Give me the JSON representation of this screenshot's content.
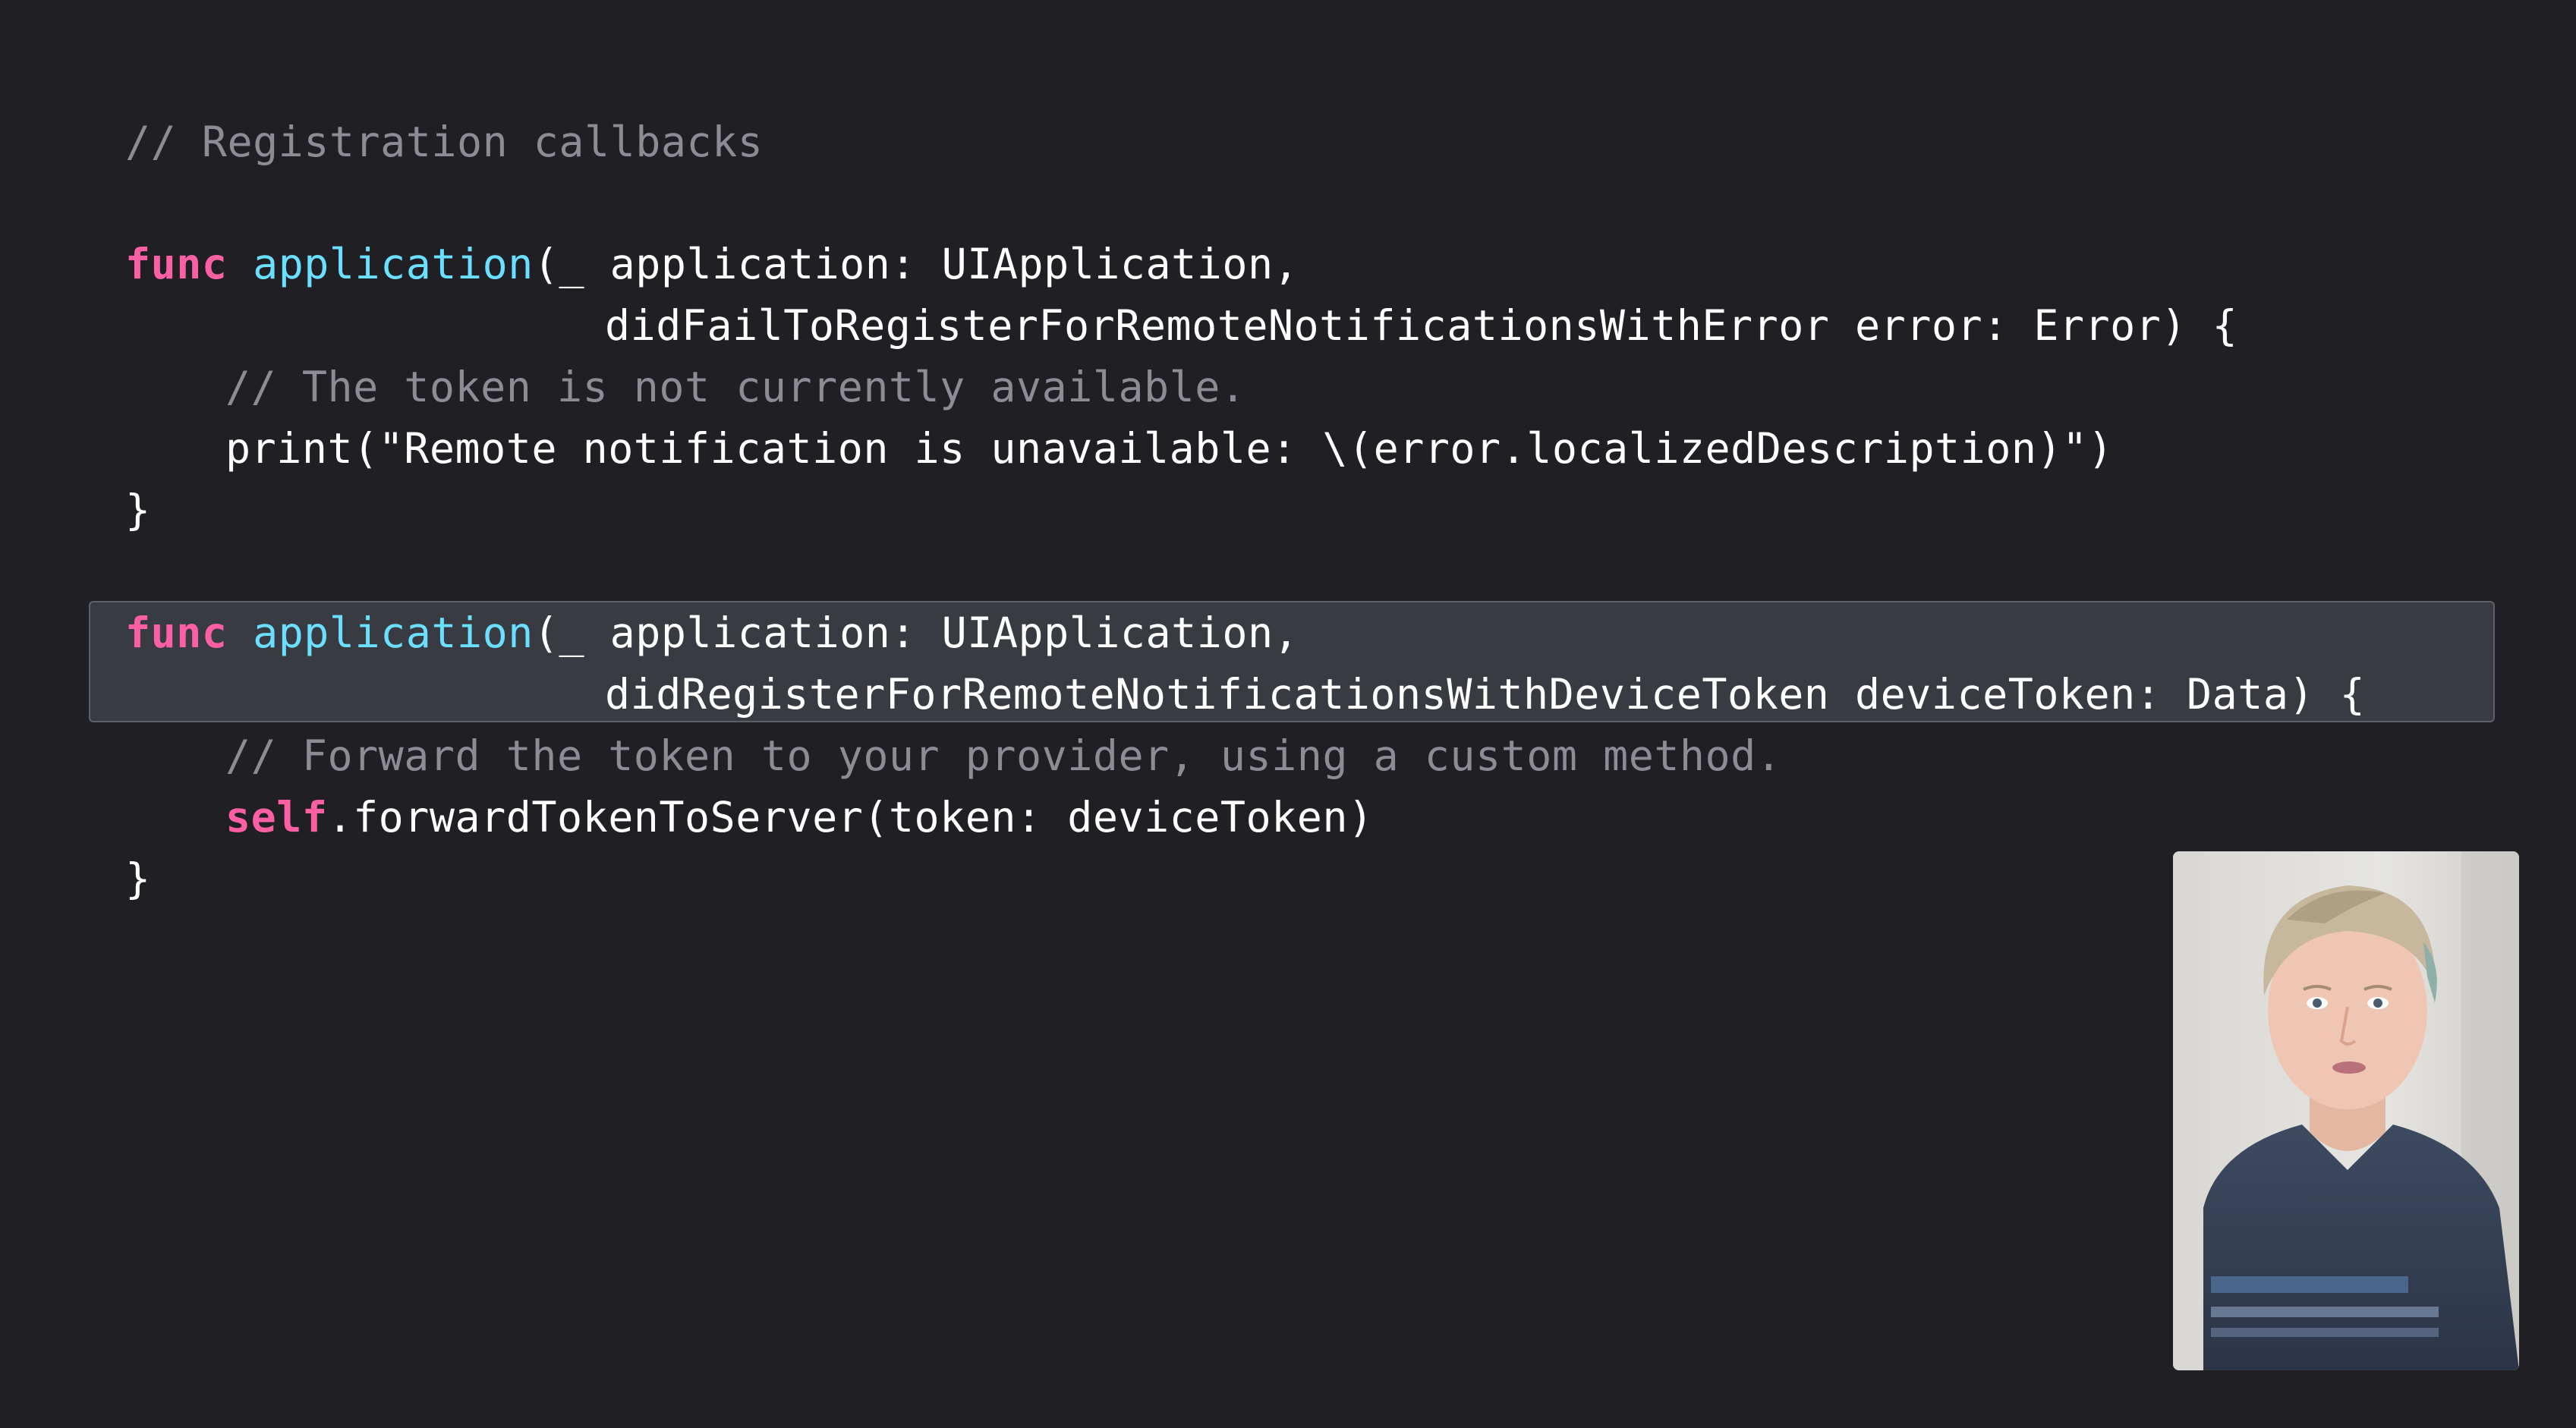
{
  "code": {
    "header_comment": "// Registration callbacks",
    "fail_func": {
      "keyword": "func",
      "name": "application",
      "line1_rest": "(_ application: UIApplication,",
      "line2": "didFailToRegisterForRemoteNotificationsWithError error: Error) {",
      "comment": "// The token is not currently available.",
      "body": "print(\"Remote notification is unavailable: \\(error.localizedDescription)\")",
      "close": "}"
    },
    "register_func": {
      "keyword": "func",
      "name": "application",
      "line1_rest": "(_ application: UIApplication,",
      "line2": "didRegisterForRemoteNotificationsWithDeviceToken deviceToken: Data) {",
      "comment": "// Forward the token to your provider, using a custom method.",
      "self_keyword": "self",
      "body_rest": ".forwardTokenToServer(token: deviceToken)",
      "close": "}"
    }
  },
  "colors": {
    "background": "#1f1f24",
    "keyword": "#fc5fa3",
    "function_name": "#6bdfff",
    "comment": "#8c8d94",
    "text": "#ffffff",
    "highlight": "#393b43"
  },
  "presenter": {
    "icon": "presenter-video-icon"
  }
}
